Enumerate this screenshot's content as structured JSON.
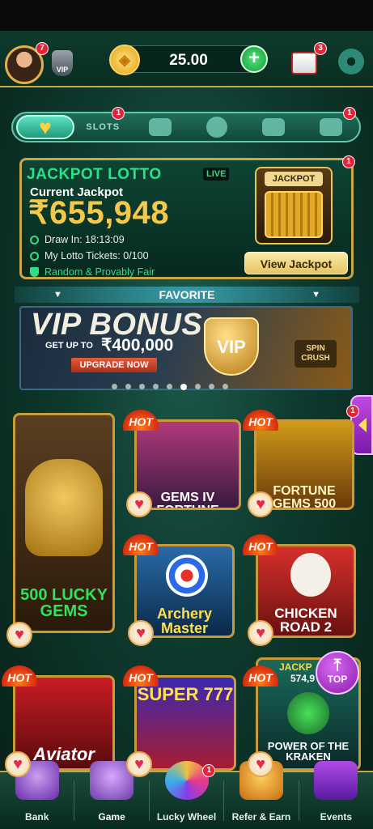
{
  "header": {
    "avatar_badge": "7",
    "vip_label": "VIP",
    "balance": "25.00",
    "mail_badge": "3"
  },
  "categories": {
    "items": [
      {
        "name": "favorite",
        "icon": "heart-icon",
        "label": ""
      },
      {
        "name": "slots",
        "icon": "slots-icon",
        "label": "SLOTS",
        "badge": "1"
      },
      {
        "name": "rocket",
        "icon": "rocket-icon",
        "label": ""
      },
      {
        "name": "roulette",
        "icon": "roulette-icon",
        "label": ""
      },
      {
        "name": "cards",
        "icon": "cards-icon",
        "label": ""
      },
      {
        "name": "fishing",
        "icon": "shark-icon",
        "label": "",
        "badge": "1"
      }
    ]
  },
  "jackpot": {
    "title": "JACKPOT LOTTO",
    "live": "LIVE",
    "subtitle": "Current Jackpot",
    "amount": "₹655,948",
    "draw_in": "Draw In: 18:13:09",
    "tickets": "My Lotto Tickets: 0/100",
    "fair": "Random & Provably Fair",
    "machine_label": "JACKPOT",
    "view_button": "View Jackpot",
    "badge": "1"
  },
  "favorite": {
    "label": "FAVORITE"
  },
  "banner": {
    "title": "VIP BONUS",
    "get_up_to": "GET UP TO",
    "amount": "₹400,000",
    "button": "UPGRADE NOW",
    "shield": "VIP",
    "brand": "SPIN CRUSH",
    "dots_total": 9,
    "dots_active": 6
  },
  "games": [
    {
      "title": "500 LUCKY GEMS",
      "hot": false
    },
    {
      "title": "GEMS IV FORTUNE",
      "hot": true,
      "hot_label": "HOT"
    },
    {
      "title": "FORTUNE GEMS 500",
      "hot": true,
      "hot_label": "HOT",
      "badge": "1"
    },
    {
      "title": "Archery Master",
      "hot": true,
      "hot_label": "HOT"
    },
    {
      "title": "CHICKEN ROAD 2",
      "hot": true,
      "hot_label": "HOT"
    },
    {
      "title": "Aviator",
      "hot": true,
      "hot_label": "HOT"
    },
    {
      "title": "SUPER 777",
      "hot": true,
      "hot_label": "HOT"
    },
    {
      "title": "POWER OF THE KRAKEN",
      "hot": true,
      "hot_label": "HOT",
      "jackpot_label": "JACKP",
      "jackpot_value": "574,9"
    }
  ],
  "top_button": "TOP",
  "bottom_nav": [
    {
      "label": "Bank",
      "icon": "bank-icon"
    },
    {
      "label": "Game",
      "icon": "slot-machine-icon",
      "active": true
    },
    {
      "label": "Lucky Wheel",
      "icon": "wheel-icon",
      "badge": "1"
    },
    {
      "label": "Refer & Earn",
      "icon": "refer-icon"
    },
    {
      "label": "Events",
      "icon": "gift-icon"
    }
  ],
  "colors": {
    "accent_gold": "#c9a647",
    "jackpot_green": "#2be086",
    "jackpot_amount": "#f6c84a",
    "badge_red": "#e0263a"
  }
}
